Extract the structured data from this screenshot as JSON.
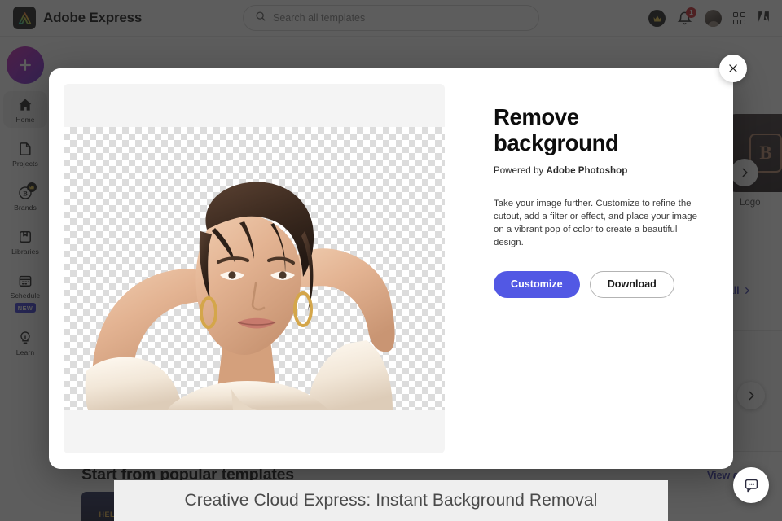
{
  "header": {
    "brand_name": "Adobe Express",
    "logo_icon": "adobe-express-logo-icon",
    "search": {
      "placeholder": "Search all templates",
      "value": "",
      "icon": "search-icon"
    },
    "premium_icon": "crown-icon",
    "notifications": {
      "icon": "bell-icon",
      "count": "1"
    },
    "avatar_name": "user-avatar",
    "apps_icon": "grid-apps-icon",
    "adobe_icon": "adobe-logo-icon"
  },
  "sidebar": {
    "create_button_label": "+",
    "create_icon": "plus-icon",
    "items": [
      {
        "label": "Home",
        "icon": "home-icon",
        "active": true,
        "badge": ""
      },
      {
        "label": "Projects",
        "icon": "document-icon",
        "active": false,
        "badge": ""
      },
      {
        "label": "Brands",
        "icon": "brand-b-icon",
        "active": false,
        "badge": "crown-badge"
      },
      {
        "label": "Libraries",
        "icon": "library-icon",
        "active": false,
        "badge": ""
      },
      {
        "label": "Schedule",
        "icon": "calendar-icon",
        "active": false,
        "badge": "NEW"
      },
      {
        "label": "Learn",
        "icon": "lightbulb-icon",
        "active": false,
        "badge": ""
      }
    ]
  },
  "background_page": {
    "logo_card_label": "Logo",
    "logo_card_icon": "brand-b-shield-icon",
    "next_arrow_icon": "chevron-right-icon",
    "view_all_label": "View all",
    "view_all_icon": "chevron-right-icon",
    "section_title": "Start from popular templates",
    "template_word": "HELLO"
  },
  "modal": {
    "close_icon": "close-icon",
    "title": "Remove background",
    "powered_by_prefix": "Powered by ",
    "powered_by_brand": "Adobe Photoshop",
    "description": "Take your image further. Customize to refine the cutout, add a filter or effect, and place your image on a vibrant pop of color to create a beautiful design.",
    "primary_button": "Customize",
    "secondary_button": "Download",
    "preview_alt": "cutout-portrait-transparent-background"
  },
  "caption": {
    "text": "Creative Cloud Express: Instant Background Removal"
  },
  "chat": {
    "icon": "chat-bubble-icon"
  },
  "colors": {
    "accent_indigo": "#5258e4",
    "link_indigo": "#3a3ab0",
    "badge_red": "#c9252d",
    "new_badge_blue": "#3b3bd6",
    "scrim": "rgba(30,30,30,0.72)",
    "caption_bg": "#efefef"
  }
}
